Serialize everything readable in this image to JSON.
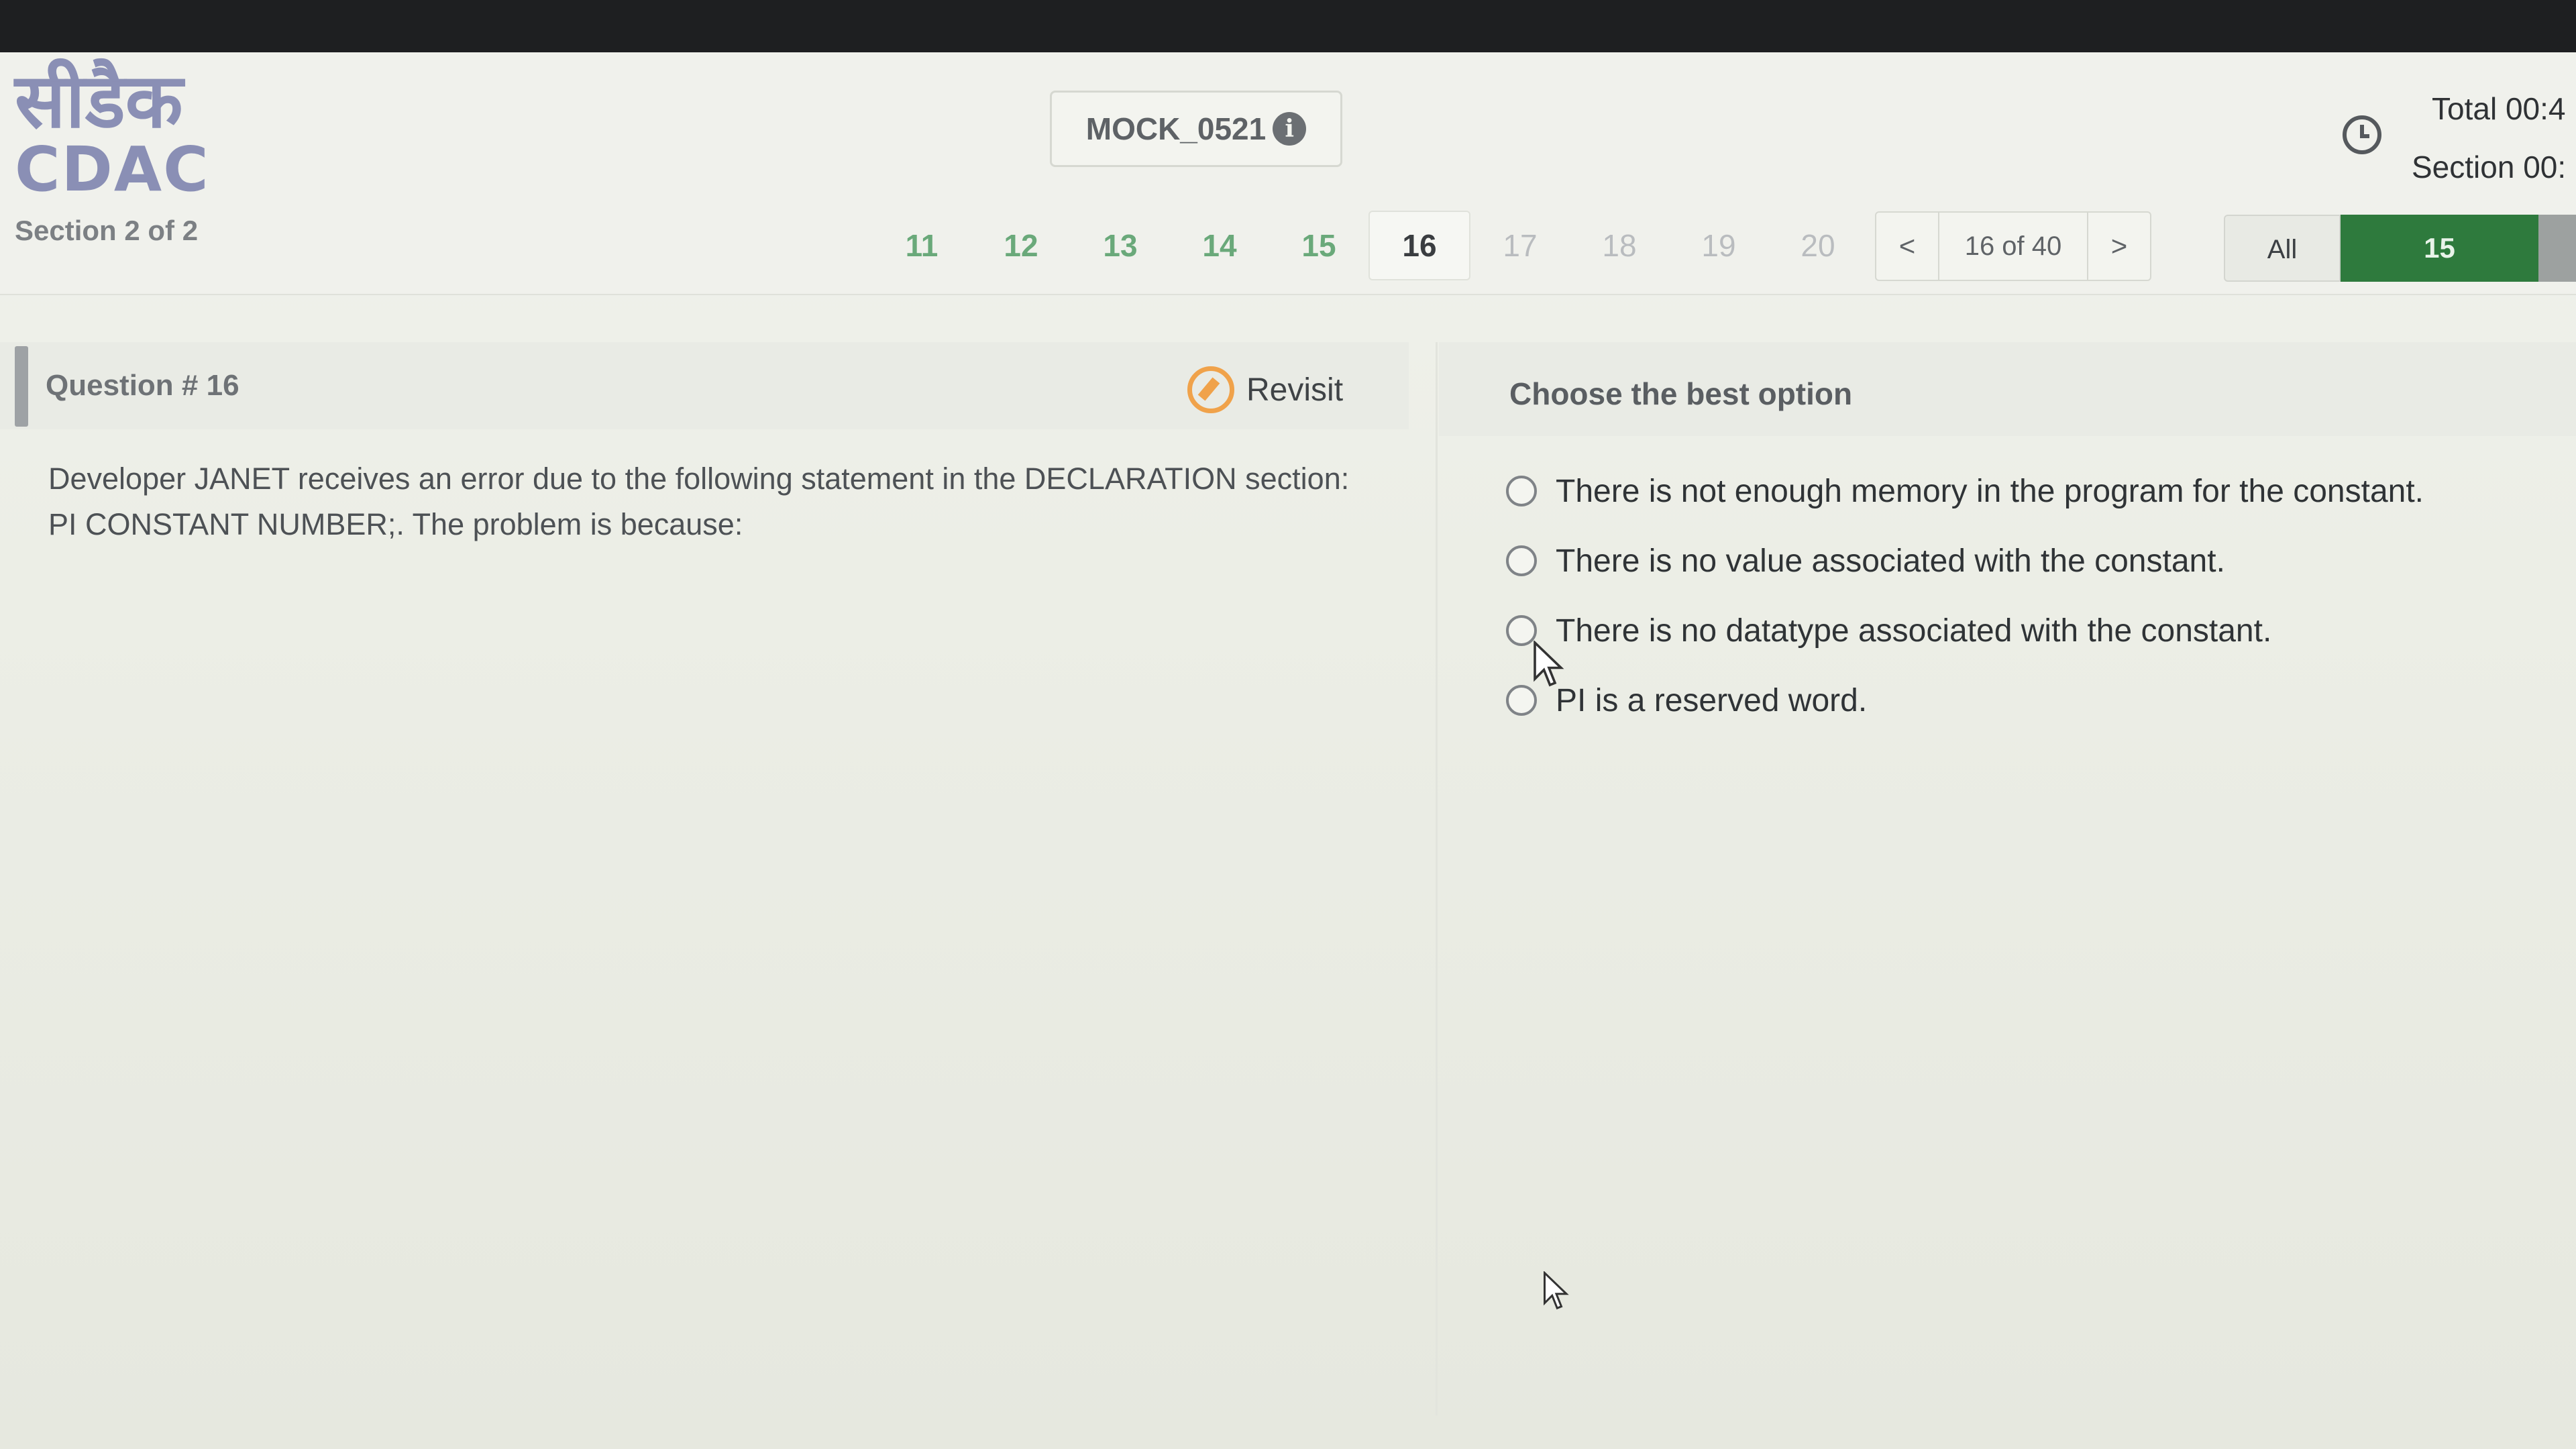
{
  "header": {
    "logo_hindi": "सीडैक",
    "logo_latin": "CDAC",
    "section_label": "Section 2 of 2",
    "mock_title": "MOCK_0521",
    "info_icon": "i"
  },
  "question_nav": {
    "numbers": [
      "11",
      "12",
      "13",
      "14",
      "15",
      "16",
      "17",
      "18",
      "19",
      "20"
    ],
    "current": "16",
    "prev_label": "<",
    "position_text": "16 of 40",
    "next_label": ">"
  },
  "filter": {
    "all_label": "All",
    "count_label": "15",
    "active_color": "#2e7a3d"
  },
  "timer": {
    "total": "Total 00:4",
    "section": "Section 00:"
  },
  "question": {
    "number_label": "Question # 16",
    "revisit_label": "Revisit",
    "text": "Developer JANET receives an error due to the following statement in the DECLARATION section: PI CONSTANT NUMBER;. The problem is because:"
  },
  "options": {
    "title": "Choose the best option",
    "items": [
      "There is not enough memory in the program for the constant.",
      "There is no value associated with the constant.",
      "There is no datatype associated with the constant.",
      "PI is a reserved word."
    ]
  },
  "icons": {
    "clock": "clock-icon",
    "revisit": "revisit-icon",
    "info": "info-icon",
    "radio": "radio-icon",
    "cursor": "cursor-icon"
  }
}
